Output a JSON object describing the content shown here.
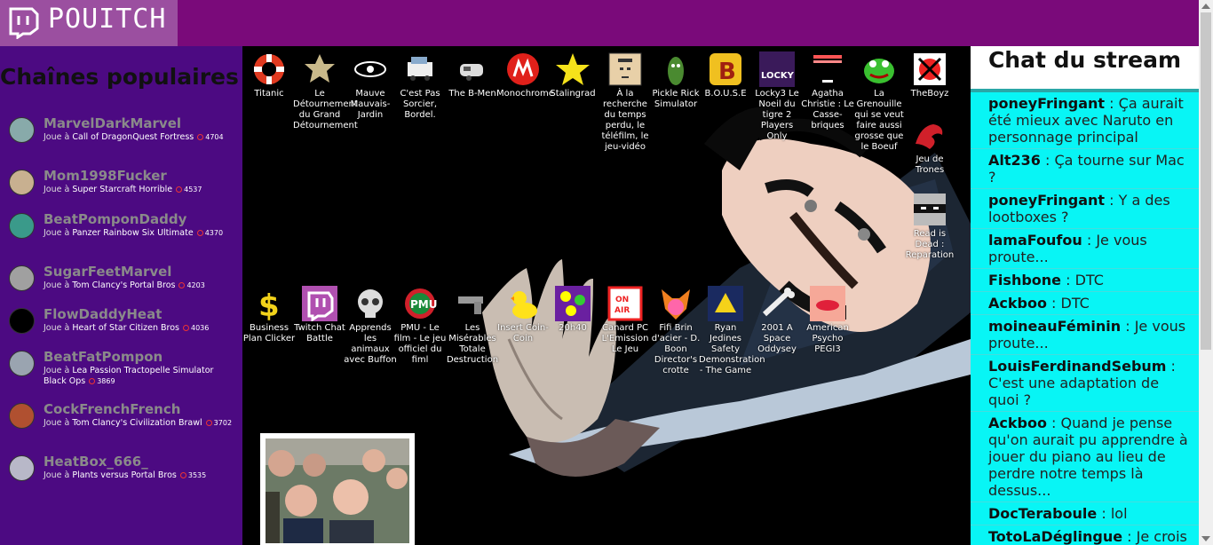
{
  "header": {
    "logo_text": "POUITCH"
  },
  "sidebar": {
    "title": "Chaînes populaires",
    "playing_prefix": "Joue à",
    "channels": [
      {
        "name": "MarvelDarkMarvel",
        "game": "Call of DragonQuest Fortress",
        "viewers": "4704"
      },
      {
        "name": "Mom1998Fucker",
        "game": "Super Starcraft Horrible",
        "viewers": "4537"
      },
      {
        "name": "BeatPomponDaddy",
        "game": "Panzer Rainbow Six Ultimate",
        "viewers": "4370"
      },
      {
        "name": "SugarFeetMarvel",
        "game": "Tom Clancy's Portal Bros",
        "viewers": "4203"
      },
      {
        "name": "FlowDaddyHeat",
        "game": "Heart of Star Citizen Bros",
        "viewers": "4036"
      },
      {
        "name": "BeatFatPompon",
        "game": "Lea Passion Tractopelle Simulator Black Ops",
        "viewers": "3869"
      },
      {
        "name": "CockFrenchFrench",
        "game": "Tom Clancy's Civilization Brawl",
        "viewers": "3702"
      },
      {
        "name": "HeatBox_666_",
        "game": "Plants versus Portal Bros",
        "viewers": "3535"
      }
    ]
  },
  "desktop_icons": [
    {
      "label": "Titanic",
      "icon": "lifebuoy-icon"
    },
    {
      "label": "Le Détournement du Grand Détournement",
      "icon": "sheriff-badge-icon"
    },
    {
      "label": "Mauve Mauvais-Jardin",
      "icon": "eye-icon"
    },
    {
      "label": "C'est Pas Sorcier, Bordel.",
      "icon": "truck-icon"
    },
    {
      "label": "The B-Men",
      "icon": "caravan-icon"
    },
    {
      "label": "Monochrome",
      "icon": "m-logo-icon"
    },
    {
      "label": "Stalingrad",
      "icon": "star-icon"
    },
    {
      "label": "À la recherche du temps perdu, le téléfilm, le jeu-vidéo",
      "icon": "portrait-icon"
    },
    {
      "label": "Pickle Rick Simulator",
      "icon": "pickle-icon"
    },
    {
      "label": "B.O.U.S.E",
      "icon": "b-logo-icon"
    },
    {
      "label": "Locky3 Le Noeil du tigre 2 Players Only",
      "icon": "locky-icon"
    },
    {
      "label": "Agatha Christie : Le Casse-briques",
      "icon": "breakout-icon"
    },
    {
      "label": "La Grenouille qui se veut faire aussi grosse que le Boeuf",
      "icon": "frog-icon"
    },
    {
      "label": "TheBoyz",
      "icon": "cube-icon"
    },
    {
      "label": "Jeu de Trones",
      "icon": "dragon-icon"
    },
    {
      "label": "Read is Dead : Reparation",
      "icon": "ninja-icon"
    },
    {
      "label": "Business Plan Clicker",
      "icon": "dollar-icon"
    },
    {
      "label": "Twitch Chat Battle",
      "icon": "twitch-logo-icon"
    },
    {
      "label": "Apprends les animaux avec Buffon",
      "icon": "skull-icon"
    },
    {
      "label": "PMU - Le film - Le jeu officiel du fiml",
      "icon": "pmu-logo-icon"
    },
    {
      "label": "Les Misérables Totale Destruction",
      "icon": "gun-icon"
    },
    {
      "label": "Insert Coin-Coin",
      "icon": "duck-icon"
    },
    {
      "label": "20h40",
      "icon": "flowers-icon"
    },
    {
      "label": "Canard PC L'Emission Le Jeu",
      "icon": "on-air-icon"
    },
    {
      "label": "Fifi Brin d'acier - D. Boon Director's crotte",
      "icon": "fox-icon"
    },
    {
      "label": "Ryan Jedines Safety Demonstration - The Game",
      "icon": "emblem-icon"
    },
    {
      "label": "2001 A Space Oddysey",
      "icon": "bone-icon"
    },
    {
      "label": "American Psycho PEGI3",
      "icon": "lips-icon"
    }
  ],
  "chat": {
    "title": "Chat du stream",
    "messages": [
      {
        "user": "poneyFringant",
        "text": "Ça aurait été mieux avec Naruto en personnage principal"
      },
      {
        "user": "Alt236",
        "text": "Ça tourne sur Mac ?"
      },
      {
        "user": "poneyFringant",
        "text": "Y a des lootboxes ?"
      },
      {
        "user": "lamaFoufou",
        "text": "Je vous proute..."
      },
      {
        "user": "Fishbone",
        "text": "DTC"
      },
      {
        "user": "Ackboo",
        "text": "DTC"
      },
      {
        "user": "moineauFéminin",
        "text": "Je vous proute..."
      },
      {
        "user": "LouisFerdinandSebum",
        "text": "C'est une adaptation de quoi ?"
      },
      {
        "user": "Ackboo",
        "text": "Quand je pense qu'on aurait pu apprendre à jouer du piano au lieu de perdre notre temps là dessus..."
      },
      {
        "user": "DocTeraboule",
        "text": "lol"
      },
      {
        "user": "TotoLaDéglingue",
        "text": "Je crois pas"
      }
    ]
  }
}
